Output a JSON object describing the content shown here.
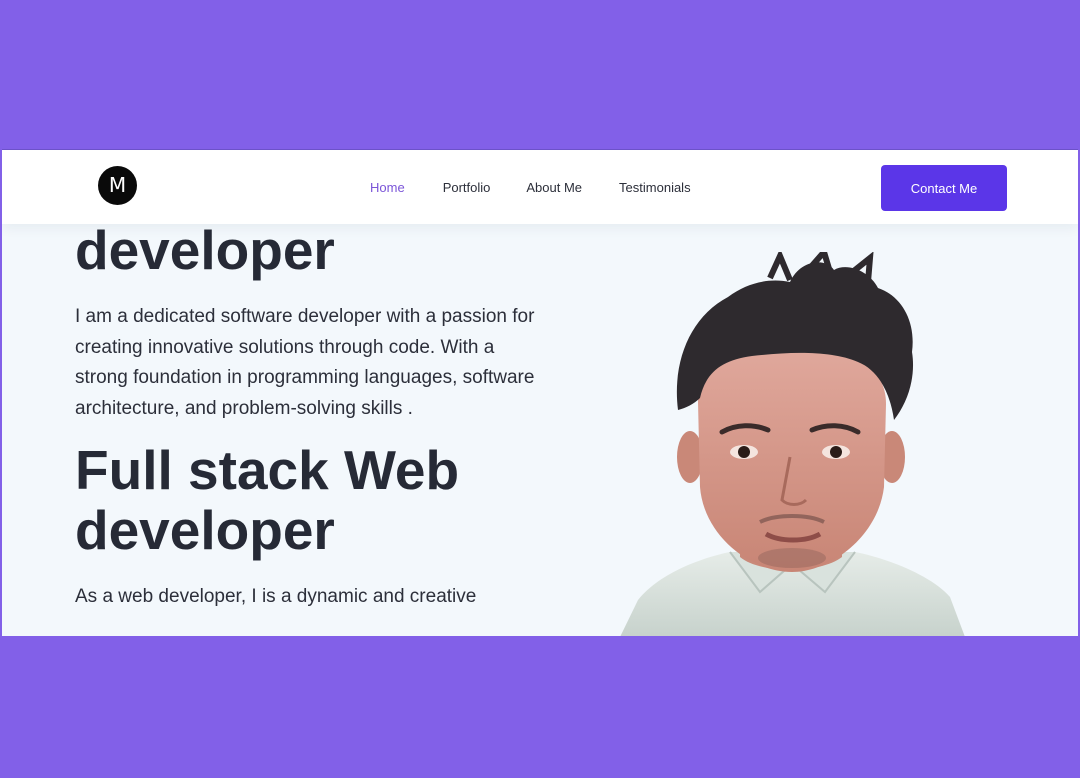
{
  "nav": {
    "logo_letter": "M",
    "links": [
      "Home",
      "Portfolio",
      "About Me",
      "Testimonials"
    ],
    "active": "Home",
    "contact_label": "Contact Me"
  },
  "hero": {
    "heading_partial": "developer",
    "intro": "I am a dedicated software developer with a passion for creating innovative solutions through code. With a strong foundation in programming languages, software architecture, and problem-solving skills .",
    "heading2_line1": "Full stack Web",
    "heading2_line2": "developer",
    "para2": "As a web developer, I is a dynamic and creative"
  },
  "colors": {
    "page_bg": "#8260e8",
    "accent": "#5b36e8",
    "active_link": "#7b55d8",
    "heading": "#262a36",
    "content_bg": "#f3f8fc"
  },
  "icons": {
    "logo": "logo-circle-m"
  }
}
